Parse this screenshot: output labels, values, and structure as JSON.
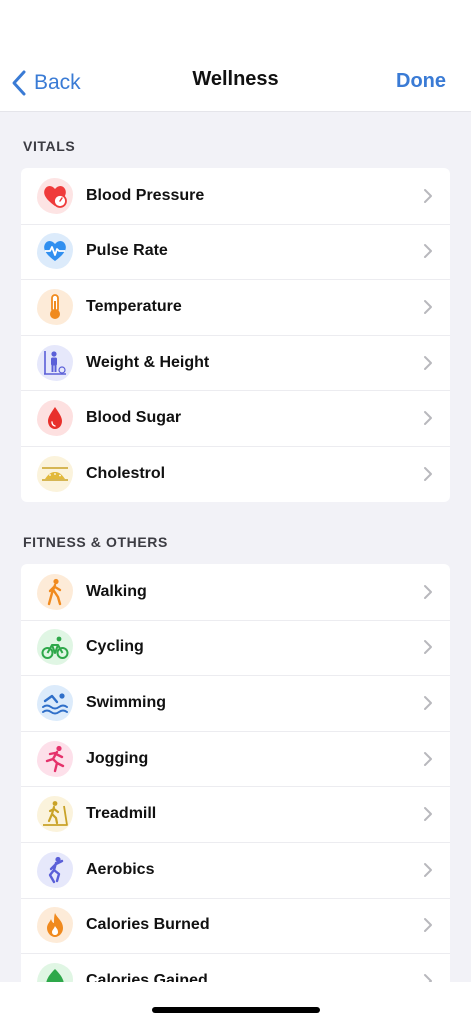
{
  "nav": {
    "back_label": "Back",
    "title": "Wellness",
    "done_label": "Done"
  },
  "colors": {
    "accent": "#3a7bd5",
    "background": "#f2f2f7"
  },
  "sections": [
    {
      "header": "VITALS",
      "items": [
        {
          "label": "Blood Pressure",
          "icon": "heart-gauge-icon"
        },
        {
          "label": "Pulse Rate",
          "icon": "heart-pulse-icon"
        },
        {
          "label": "Temperature",
          "icon": "thermometer-icon"
        },
        {
          "label": "Weight & Height",
          "icon": "person-scale-icon"
        },
        {
          "label": "Blood Sugar",
          "icon": "blood-drop-icon"
        },
        {
          "label": "Cholestrol",
          "icon": "artery-icon"
        }
      ]
    },
    {
      "header": "FITNESS & OTHERS",
      "items": [
        {
          "label": "Walking",
          "icon": "walking-icon"
        },
        {
          "label": "Cycling",
          "icon": "cycling-icon"
        },
        {
          "label": "Swimming",
          "icon": "swimming-icon"
        },
        {
          "label": "Jogging",
          "icon": "jogging-icon"
        },
        {
          "label": "Treadmill",
          "icon": "treadmill-icon"
        },
        {
          "label": "Aerobics",
          "icon": "aerobics-icon"
        },
        {
          "label": "Calories Burned",
          "icon": "flame-icon"
        },
        {
          "label": "Calories Gained",
          "icon": "leaf-icon"
        }
      ]
    }
  ]
}
